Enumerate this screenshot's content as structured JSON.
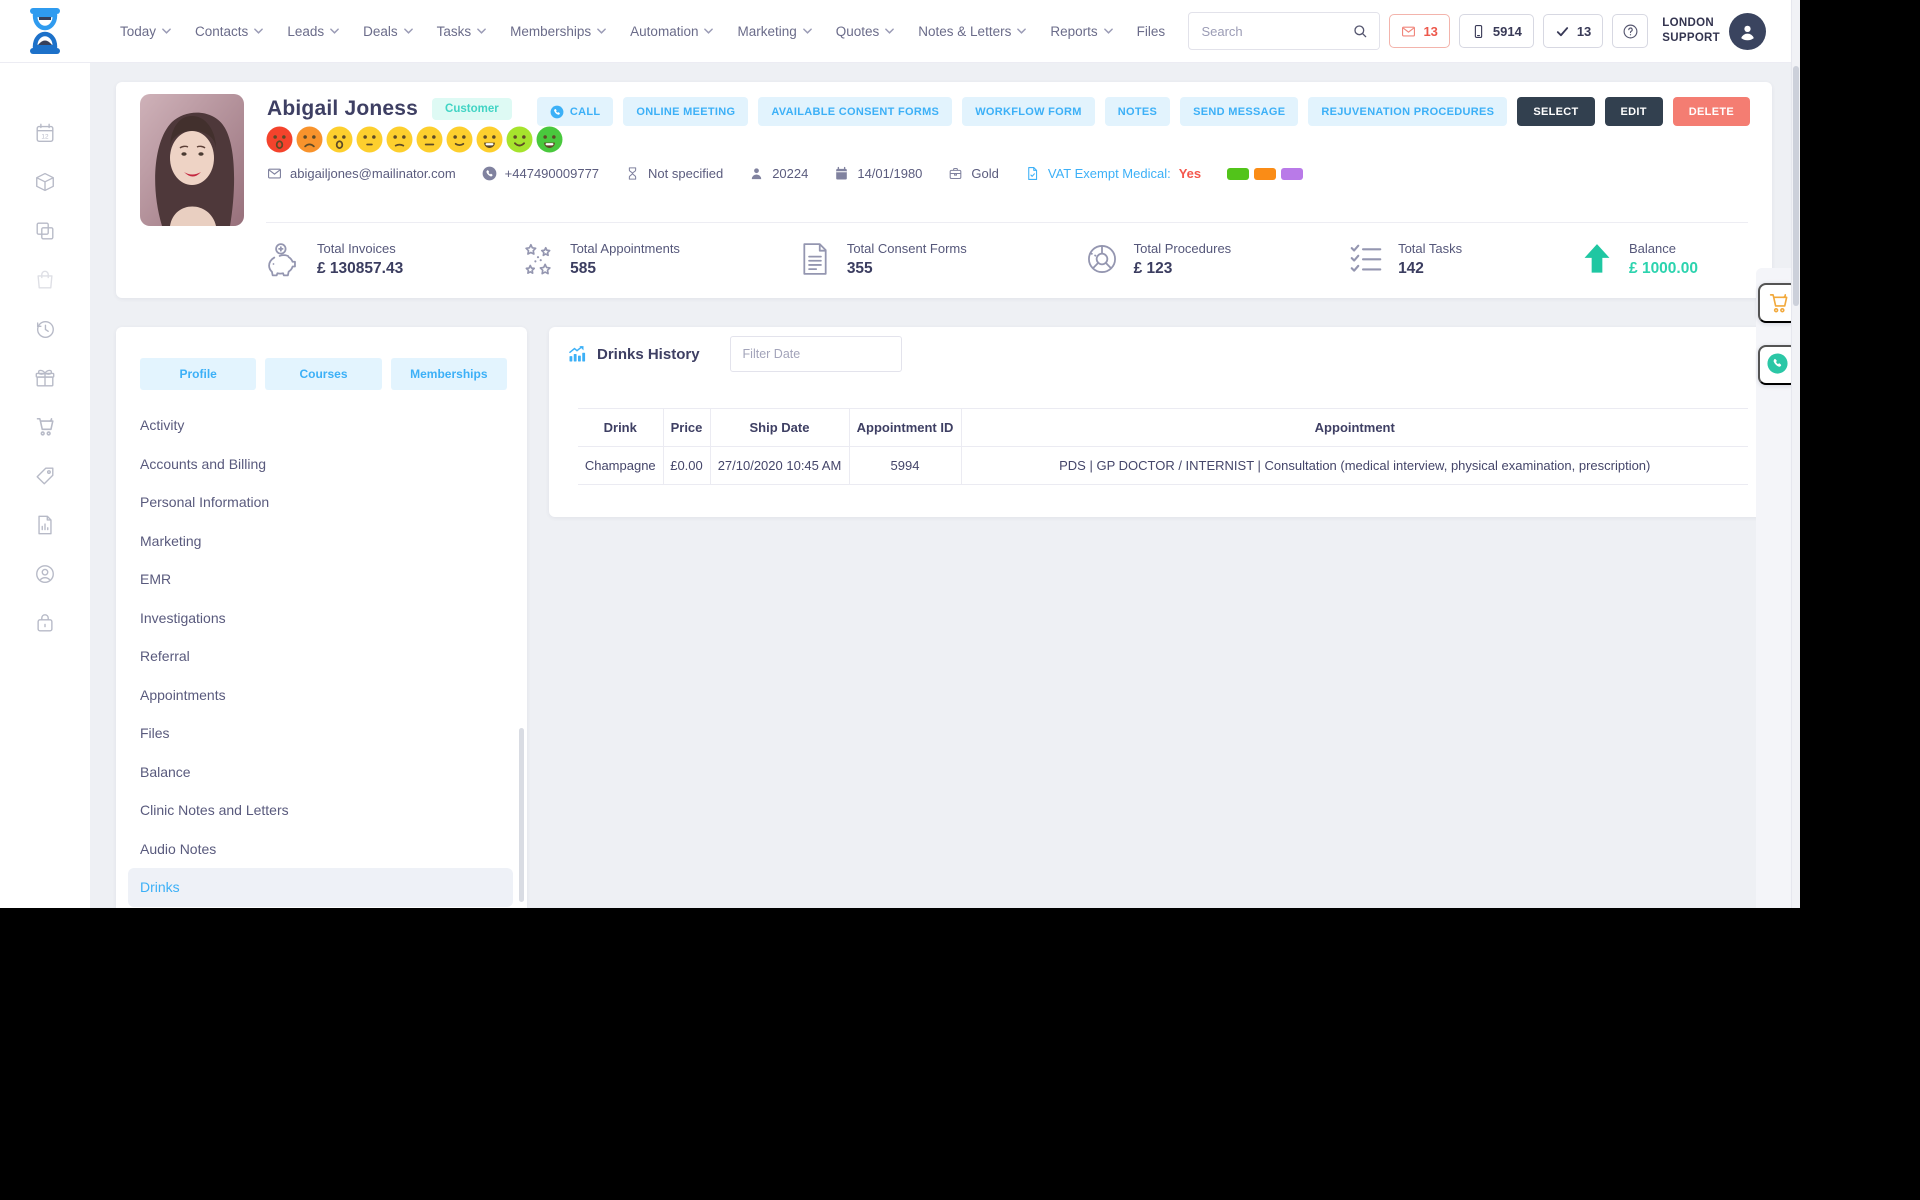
{
  "navbar": {
    "logo_icon": "hourglass-logo-icon",
    "items": [
      {
        "label": "Today",
        "caret": true
      },
      {
        "label": "Contacts",
        "caret": true
      },
      {
        "label": "Leads",
        "caret": true
      },
      {
        "label": "Deals",
        "caret": true
      },
      {
        "label": "Tasks",
        "caret": true
      },
      {
        "label": "Memberships",
        "caret": true
      },
      {
        "label": "Automation",
        "caret": true
      },
      {
        "label": "Marketing",
        "caret": true
      },
      {
        "label": "Quotes",
        "caret": true
      },
      {
        "label": "Notes & Letters",
        "caret": true
      },
      {
        "label": "Reports",
        "caret": true
      },
      {
        "label": "Files",
        "caret": false
      }
    ],
    "search_placeholder": "Search",
    "search_icon": "search-icon",
    "indicators": [
      {
        "icon": "mail-icon",
        "count": "13",
        "style": "alert"
      },
      {
        "icon": "smartphone-icon",
        "count": "5914",
        "style": "plain"
      },
      {
        "icon": "check-icon",
        "count": "13",
        "style": "plain"
      }
    ],
    "help_icon": "help-icon",
    "user": {
      "line1": "LONDON",
      "line2": "SUPPORT",
      "avatar_icon": "user-avatar-icon"
    }
  },
  "sidebar": {
    "items": [
      {
        "icon": "calendar-date-icon"
      },
      {
        "icon": "package-icon"
      },
      {
        "icon": "copy-icon"
      },
      {
        "icon": "shopping-bag-icon",
        "dim": true
      },
      {
        "icon": "history-icon"
      },
      {
        "icon": "gift-icon"
      },
      {
        "icon": "cart-icon"
      },
      {
        "icon": "price-tag-icon"
      },
      {
        "icon": "report-icon"
      },
      {
        "icon": "user-circle-icon"
      },
      {
        "icon": "lock-icon"
      }
    ]
  },
  "profile": {
    "name": "Abigail Joness",
    "badge": "Customer",
    "mood_scale": [
      {
        "color": "#f4432c",
        "mouth": "sad-open"
      },
      {
        "color": "#f8932c",
        "mouth": "frown"
      },
      {
        "color": "#fdcf2e",
        "mouth": "sad-open"
      },
      {
        "color": "#fdcf2e",
        "mouth": "flat-small"
      },
      {
        "color": "#fdcf2e",
        "mouth": "slight-frown"
      },
      {
        "color": "#fdcf2e",
        "mouth": "flat"
      },
      {
        "color": "#fdcf2e",
        "mouth": "slight-smile"
      },
      {
        "color": "#fdcf2e",
        "mouth": "grin"
      },
      {
        "color": "#a6e32d",
        "mouth": "smile"
      },
      {
        "color": "#49c83d",
        "mouth": "grin"
      }
    ],
    "actions": [
      {
        "label": "CALL",
        "icon": "call-icon",
        "style": "light"
      },
      {
        "label": "ONLINE MEETING",
        "style": "light"
      },
      {
        "label": "AVAILABLE CONSENT FORMS",
        "style": "light"
      },
      {
        "label": "WORKFLOW FORM",
        "style": "light"
      },
      {
        "label": "NOTES",
        "style": "light"
      },
      {
        "label": "SEND MESSAGE",
        "style": "light"
      },
      {
        "label": "REJUVENATION PROCEDURES",
        "style": "light"
      },
      {
        "label": "SELECT",
        "style": "dark"
      },
      {
        "label": "EDIT",
        "style": "dark"
      },
      {
        "label": "DELETE",
        "style": "danger"
      }
    ],
    "contact": [
      {
        "icon": "mail-icon",
        "text": "abigailjones@mailinator.com"
      },
      {
        "icon": "call-icon",
        "text": "+447490009777"
      },
      {
        "icon": "hourglass-icon",
        "text": "Not specified"
      },
      {
        "icon": "person-icon",
        "text": "20224"
      },
      {
        "icon": "calendar-icon",
        "text": "14/01/1980"
      },
      {
        "icon": "briefcase-icon",
        "text": "Gold"
      },
      {
        "icon": "document-icon",
        "text": "VAT Exempt Medical:",
        "suffix": "Yes",
        "tone": "blue"
      }
    ],
    "flags": [
      "#52c41a",
      "#fa8c16",
      "#b97ae8"
    ],
    "stats": [
      {
        "icon": "piggy-bank-icon",
        "label": "Total Invoices",
        "value": "£ 130857.43"
      },
      {
        "icon": "confetti-icon",
        "label": "Total Appointments",
        "value": "585"
      },
      {
        "icon": "consent-form-icon",
        "label": "Total Consent Forms",
        "value": "355"
      },
      {
        "icon": "donut-chart-icon",
        "label": "Total Procedures",
        "value": "£ 123"
      },
      {
        "icon": "task-list-icon",
        "label": "Total Tasks",
        "value": "142"
      },
      {
        "icon": "arrow-up-icon",
        "label": "Balance",
        "value": "£ 1000.00",
        "accent": "teal"
      }
    ]
  },
  "left_panel": {
    "tabs": [
      "Profile",
      "Courses",
      "Memberships"
    ],
    "menu": [
      {
        "label": "Activity"
      },
      {
        "label": "Accounts and Billing"
      },
      {
        "label": "Personal Information"
      },
      {
        "label": "Marketing"
      },
      {
        "label": "EMR"
      },
      {
        "label": "Investigations"
      },
      {
        "label": "Referral"
      },
      {
        "label": "Appointments"
      },
      {
        "label": "Files"
      },
      {
        "label": "Balance"
      },
      {
        "label": "Clinic Notes and Letters"
      },
      {
        "label": "Audio Notes"
      },
      {
        "label": "Drinks",
        "active": true
      }
    ]
  },
  "drinks": {
    "title": "Drinks History",
    "title_icon": "chart-icon",
    "filter_placeholder": "Filter Date",
    "table": {
      "headers": [
        "Drink",
        "Price",
        "Ship Date",
        "Appointment ID",
        "Appointment"
      ],
      "rows": [
        {
          "drink": "Champagne",
          "price": "£0.00",
          "ship_date": "27/10/2020 10:45 AM",
          "appointment_id": "5994",
          "appointment": "PDS | GP DOCTOR / INTERNIST | Consultation (medical interview, physical examination, prescription)"
        }
      ]
    }
  },
  "floating": {
    "icons": [
      "cart-icon",
      "whatsapp-icon"
    ]
  }
}
